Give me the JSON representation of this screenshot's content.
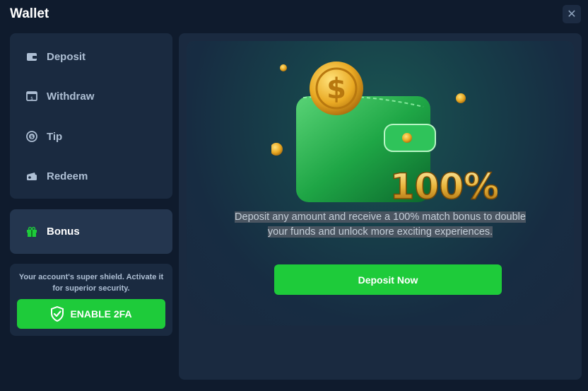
{
  "window": {
    "title": "Wallet"
  },
  "sidebar": {
    "items": [
      {
        "label": "Deposit",
        "icon": "wallet-icon"
      },
      {
        "label": "Withdraw",
        "icon": "withdraw-icon"
      },
      {
        "label": "Tip",
        "icon": "coin-icon"
      },
      {
        "label": "Redeem",
        "icon": "redeem-icon"
      }
    ],
    "bonus": {
      "label": "Bonus",
      "icon": "gift-icon"
    }
  },
  "security": {
    "text": "Your account's super shield. Activate it for superior security.",
    "button_label": "ENABLE 2FA",
    "icon": "shield-check-icon"
  },
  "promo": {
    "badge": "100%",
    "text_line1": "Deposit any amount and receive a 100% match bonus to double",
    "text_line2": "your funds and unlock more exciting experiences.",
    "button_label": "Deposit Now"
  },
  "colors": {
    "accent": "#1ecb3a",
    "background": "#0f1b2d",
    "panel": "#1a2a40"
  }
}
